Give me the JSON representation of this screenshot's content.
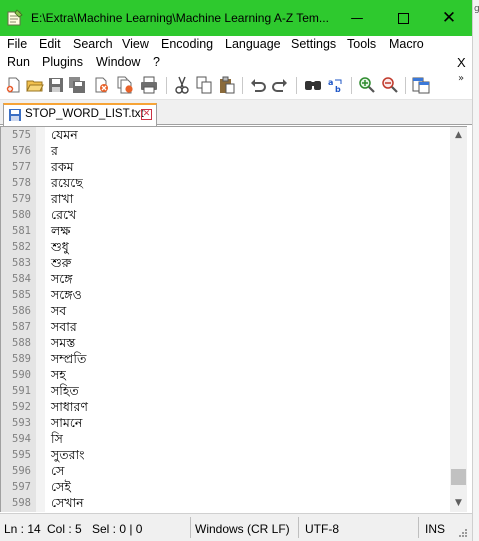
{
  "window": {
    "title": "E:\\Extra\\Machine Learning\\Machine Learning A-Z Tem...",
    "minimize_glyph": "—",
    "maximize_glyph": "☐",
    "close_glyph": "✕",
    "titlebar_color": "#2ec92e",
    "edge_glyph": "g"
  },
  "menu": {
    "row1": [
      "File",
      "Edit",
      "Search",
      "View",
      "Encoding",
      "Language",
      "Settings",
      "Tools",
      "Macro"
    ],
    "row2": [
      "Run",
      "Plugins",
      "Window",
      "?"
    ],
    "close_label": "X"
  },
  "toolbar": {
    "icons": [
      "new-file-icon",
      "open-file-icon",
      "save-icon",
      "save-all-icon",
      "close-icon",
      "close-all-icon",
      "print-icon",
      "cut-icon",
      "copy-icon",
      "paste-icon",
      "undo-icon",
      "redo-icon",
      "find-icon",
      "replace-icon",
      "zoom-in-icon",
      "zoom-out-icon",
      "sync-scroll-icon"
    ],
    "overflow_glyph": "»"
  },
  "tabs": [
    {
      "label": "STOP_WORD_LIST.txt",
      "close_glyph": "✕",
      "active": true,
      "accent": "#f7a436"
    }
  ],
  "editor": {
    "lines": [
      {
        "num": "575",
        "text": "যেমন"
      },
      {
        "num": "576",
        "text": "র"
      },
      {
        "num": "577",
        "text": "রকম"
      },
      {
        "num": "578",
        "text": "রয়েছে"
      },
      {
        "num": "579",
        "text": "রাখা"
      },
      {
        "num": "580",
        "text": "রেখে"
      },
      {
        "num": "581",
        "text": "লক্ষ"
      },
      {
        "num": "582",
        "text": "শুধু"
      },
      {
        "num": "583",
        "text": "শুরু"
      },
      {
        "num": "584",
        "text": "সঙ্গে"
      },
      {
        "num": "585",
        "text": "সঙ্গেও"
      },
      {
        "num": "586",
        "text": "সব"
      },
      {
        "num": "587",
        "text": "সবার"
      },
      {
        "num": "588",
        "text": "সমস্ত"
      },
      {
        "num": "589",
        "text": "সম্প্রতি"
      },
      {
        "num": "590",
        "text": "সহ"
      },
      {
        "num": "591",
        "text": "সহিত"
      },
      {
        "num": "592",
        "text": "সাধারণ"
      },
      {
        "num": "593",
        "text": "সামনে"
      },
      {
        "num": "594",
        "text": "সি"
      },
      {
        "num": "595",
        "text": "সুতরাং"
      },
      {
        "num": "596",
        "text": "সে"
      },
      {
        "num": "597",
        "text": "সেই"
      },
      {
        "num": "598",
        "text": "সেখান"
      }
    ],
    "scroll_position": 0.97,
    "scroll_up_glyph": "▲",
    "scroll_down_glyph": "▼"
  },
  "status": {
    "line": "Ln : 14",
    "col": "Col : 5",
    "sel": "Sel : 0 | 0",
    "eol": "Windows (CR LF)",
    "encoding": "UTF-8",
    "mode": "INS"
  }
}
